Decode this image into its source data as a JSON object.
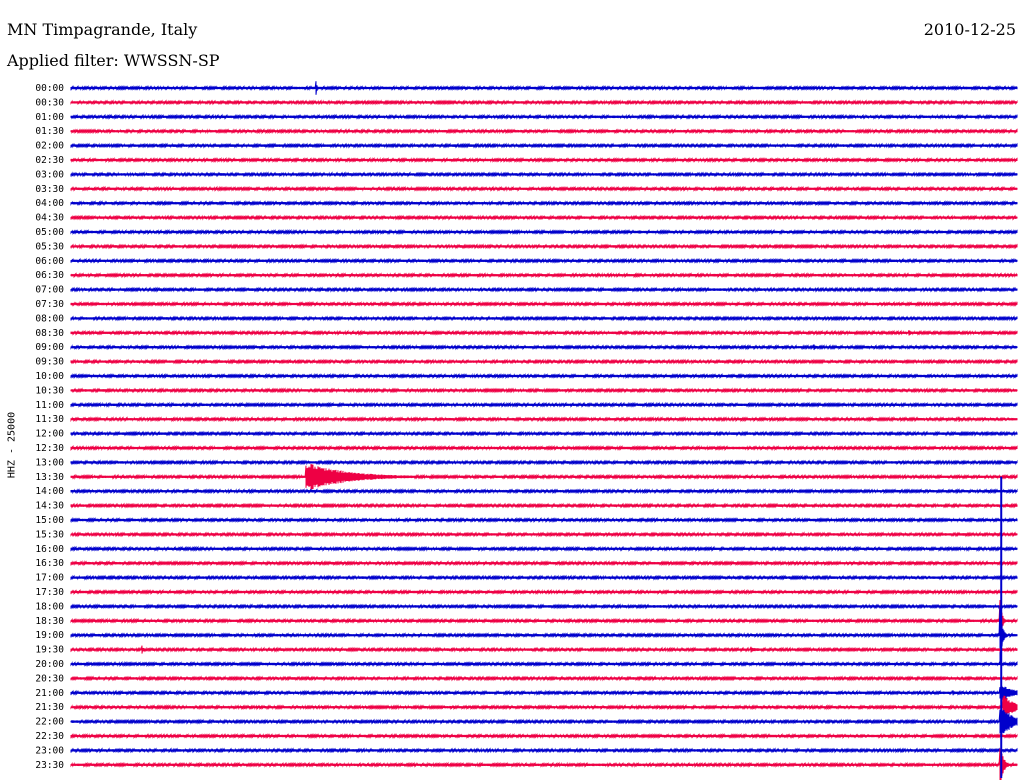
{
  "header": {
    "station": "MN Timpagrande, Italy",
    "date": "2010-12-25",
    "filter": "Applied filter: WWSSN-SP"
  },
  "chart_data": {
    "type": "line",
    "ylabel": "HHZ - 25000",
    "rows": [
      "00:00",
      "00:30",
      "01:00",
      "01:30",
      "02:00",
      "02:30",
      "03:00",
      "03:30",
      "04:00",
      "04:30",
      "05:00",
      "05:30",
      "06:00",
      "06:30",
      "07:00",
      "07:30",
      "08:00",
      "08:30",
      "09:00",
      "09:30",
      "10:00",
      "10:30",
      "11:00",
      "11:30",
      "12:00",
      "12:30",
      "13:00",
      "13:30",
      "14:00",
      "14:30",
      "15:00",
      "15:30",
      "16:00",
      "16:30",
      "17:00",
      "17:30",
      "18:00",
      "18:30",
      "19:00",
      "19:30",
      "20:00",
      "20:30",
      "21:00",
      "21:30",
      "22:00",
      "22:30",
      "23:00",
      "23:30"
    ],
    "colors": [
      "#0000cc",
      "#ee0044"
    ],
    "events": [
      {
        "row": "13:30",
        "minute": 7.5,
        "peak": 14,
        "duration_min": 4
      },
      {
        "row": "23:30",
        "minute": 29.5,
        "peak": 18,
        "duration_min": 0.3
      },
      {
        "row": "22:00",
        "minute": 29.5,
        "peak": 16,
        "duration_min": 1.2
      },
      {
        "row": "21:30",
        "minute": 29.6,
        "peak": 12,
        "duration_min": 1.0
      },
      {
        "row": "21:00",
        "minute": 29.5,
        "peak": 8,
        "duration_min": 1.5
      },
      {
        "row": "19:00",
        "minute": 29.5,
        "peak": 20,
        "duration_min": 0.2
      },
      {
        "row": "18:30",
        "minute": 29.5,
        "peak": 14,
        "duration_min": 0.2
      },
      {
        "row": "05:00",
        "minute": 18.0,
        "peak": 2,
        "duration_min": 1.0
      },
      {
        "row": "08:30",
        "minute": 26.6,
        "peak": 3,
        "duration_min": 0.3
      },
      {
        "row": "09:00",
        "minute": 23.6,
        "peak": 2,
        "duration_min": 0.3
      },
      {
        "row": "19:30",
        "minute": 21.6,
        "peak": 2.5,
        "duration_min": 0.8
      },
      {
        "row": "19:30",
        "minute": 2.3,
        "peak": 2,
        "duration_min": 0.2
      },
      {
        "row": "00:00",
        "minute": 7.8,
        "peak": 4,
        "duration_min": 0.1
      },
      {
        "row": "11:30",
        "minute": 28.2,
        "peak": 2,
        "duration_min": 0.2
      },
      {
        "row": "21:00",
        "minute": 28.0,
        "peak": 2,
        "duration_min": 0.2
      }
    ]
  }
}
